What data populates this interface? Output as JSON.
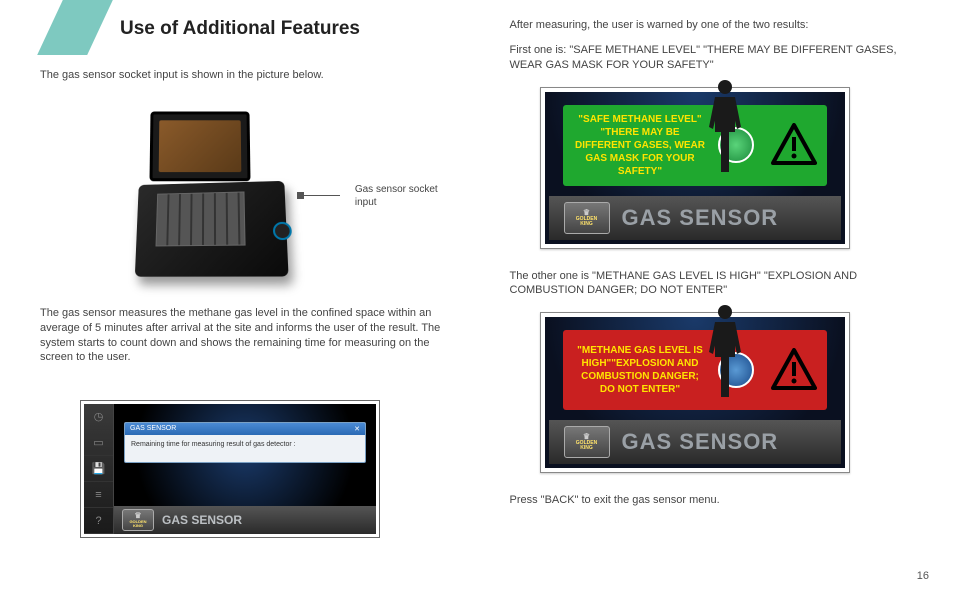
{
  "page": {
    "title": "Use of Additional Features",
    "number": "16"
  },
  "left": {
    "intro": "The gas sensor socket input is shown in the picture below.",
    "callout": "Gas sensor socket input",
    "desc": "The gas sensor measures the methane gas level in the confined space within an average of 5 minutes after arrival at the site and  informs the user of the result. The system starts to count down and shows the remaining time for measuring on the screen to the user.",
    "dialog_title": "GAS SENSOR",
    "dialog_close": "✕",
    "dialog_text": "Remaining time for measuring result of gas detector   :",
    "titlebar": "GAS SENSOR",
    "crest_line1": "GOLDEN",
    "crest_line2": "KING"
  },
  "right": {
    "intro1": "After measuring, the user is warned by one of the two results:",
    "intro2": "First one is: \"SAFE METHANE LEVEL\" \"THERE MAY BE DIFFERENT GASES, WEAR GAS MASK FOR YOUR SAFETY\"",
    "green_msg": "\"SAFE METHANE LEVEL\" \"THERE MAY BE DIFFERENT GASES, WEAR GAS MASK FOR YOUR SAFETY\"",
    "mid": "The other one is \"METHANE GAS LEVEL IS HIGH\" \"EXPLOSION AND COMBUSTION DANGER; DO NOT ENTER\"",
    "red_msg": "\"METHANE GAS LEVEL IS HIGH\"\"EXPLOSION AND COMBUSTION DANGER; DO NOT ENTER\"",
    "titlebar": "GAS SENSOR",
    "crest_line1": "GOLDEN",
    "crest_line2": "KING",
    "outro": "Press \"BACK\" to exit the gas sensor menu."
  },
  "icons": {
    "warn": "warning-triangle-icon",
    "person": "person-standing-icon"
  }
}
